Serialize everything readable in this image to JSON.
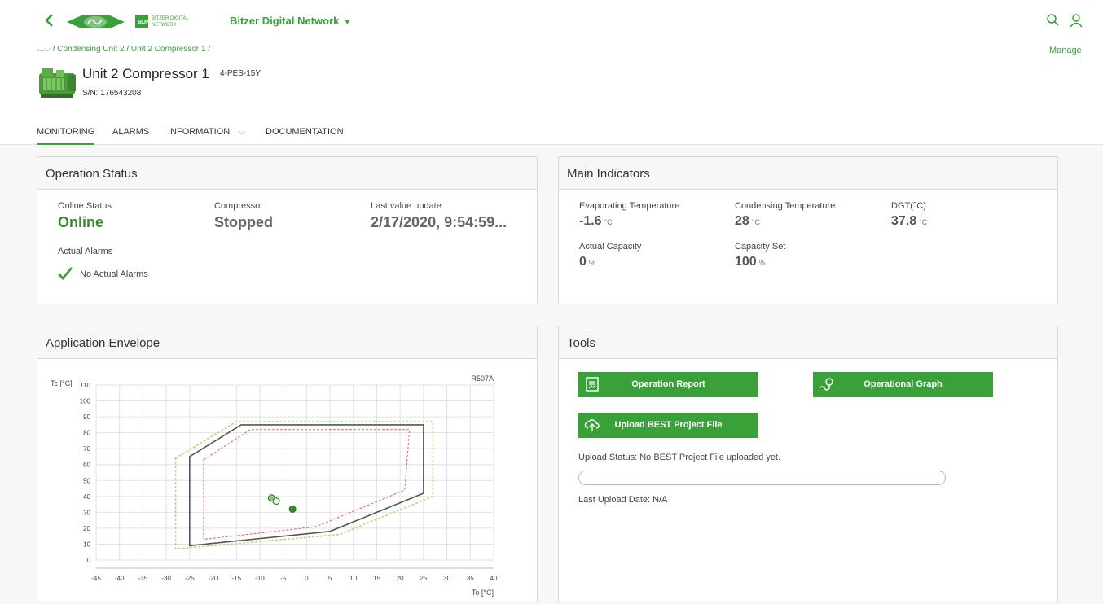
{
  "header": {
    "network_label": "Bitzer Digital Network",
    "bdn_logo_text": [
      "BITZER DIGITAL",
      "NETWORK"
    ],
    "manage_label": "Manage"
  },
  "breadcrumb": {
    "ellipsis": "...",
    "items": [
      "Condensing Unit 2",
      "Unit 2 Compressor 1"
    ]
  },
  "device": {
    "name": "Unit 2 Compressor 1",
    "model": "4-PES-15Y",
    "serial": "S/N: 176543208"
  },
  "tabs": [
    {
      "label": "MONITORING",
      "active": true
    },
    {
      "label": "ALARMS",
      "active": false
    },
    {
      "label": "INFORMATION",
      "active": false
    },
    {
      "label": "DOCUMENTATION",
      "active": false
    }
  ],
  "operation_status": {
    "title": "Operation Status",
    "online_label": "Online Status",
    "online_value": "Online",
    "compressor_label": "Compressor",
    "compressor_value": "Stopped",
    "last_update_label": "Last value update",
    "last_update_value": "2/17/2020, 9:54:59...",
    "alarms_label": "Actual Alarms",
    "alarms_value": "No Actual Alarms"
  },
  "main_indicators": {
    "title": "Main Indicators",
    "items": [
      {
        "label": "Evaporating Temperature",
        "value": "-1.6",
        "unit": "°C"
      },
      {
        "label": "Condensing Temperature",
        "value": "28",
        "unit": "°C"
      },
      {
        "label": "DGT(°C)",
        "value": "37.8",
        "unit": "°C"
      },
      {
        "label": "Actual Capacity",
        "value": "0",
        "unit": "%"
      },
      {
        "label": "Capacity Set",
        "value": "100",
        "unit": "%"
      }
    ]
  },
  "envelope": {
    "title": "Application Envelope"
  },
  "tools": {
    "title": "Tools",
    "operation_report": "Operation Report",
    "operational_graph": "Operational Graph",
    "upload_best": "Upload BEST Project File",
    "upload_status": "Upload Status: No BEST Project File uploaded yet.",
    "upload_progress": 0,
    "last_upload": "Last Upload Date: N/A"
  },
  "colors": {
    "accent": "#3aa13a",
    "status_green": "#3a8a35",
    "envelope_outline": "#555555",
    "envelope_inner": "#e06060",
    "envelope_outer": "#b5d77a"
  },
  "chart_data": {
    "type": "scatter",
    "title": "",
    "refrigerant_label": "R507A",
    "xlabel": "To [°C]",
    "ylabel": "Tc [°C]",
    "xlim": [
      -45,
      40
    ],
    "ylim": [
      0,
      110
    ],
    "xticks": [
      -45,
      -40,
      -35,
      -30,
      -25,
      -20,
      -15,
      -10,
      -5,
      0,
      5,
      10,
      15,
      20,
      25,
      30,
      35,
      40
    ],
    "yticks": [
      0,
      10,
      20,
      30,
      40,
      50,
      60,
      70,
      80,
      90,
      100,
      110
    ],
    "grid": true,
    "envelope_outline": [
      [
        -25,
        65
      ],
      [
        -14,
        85
      ],
      [
        25,
        85
      ],
      [
        25,
        42
      ],
      [
        5,
        18
      ],
      [
        -25,
        9
      ]
    ],
    "envelope_inner": [
      [
        -22,
        63
      ],
      [
        -12,
        82
      ],
      [
        22,
        82
      ],
      [
        21,
        44
      ],
      [
        2,
        21
      ],
      [
        -22,
        13
      ]
    ],
    "envelope_outer": [
      [
        -28,
        64
      ],
      [
        -15,
        87
      ],
      [
        27,
        87
      ],
      [
        27,
        40
      ],
      [
        7,
        16
      ],
      [
        -28,
        7
      ]
    ],
    "points": [
      {
        "x": -7.5,
        "y": 39,
        "fill": "#8cc87a"
      },
      {
        "x": -6.5,
        "y": 37,
        "fill": "#e8f3dc"
      },
      {
        "x": -3,
        "y": 32,
        "fill": "#3a8a35"
      }
    ]
  }
}
